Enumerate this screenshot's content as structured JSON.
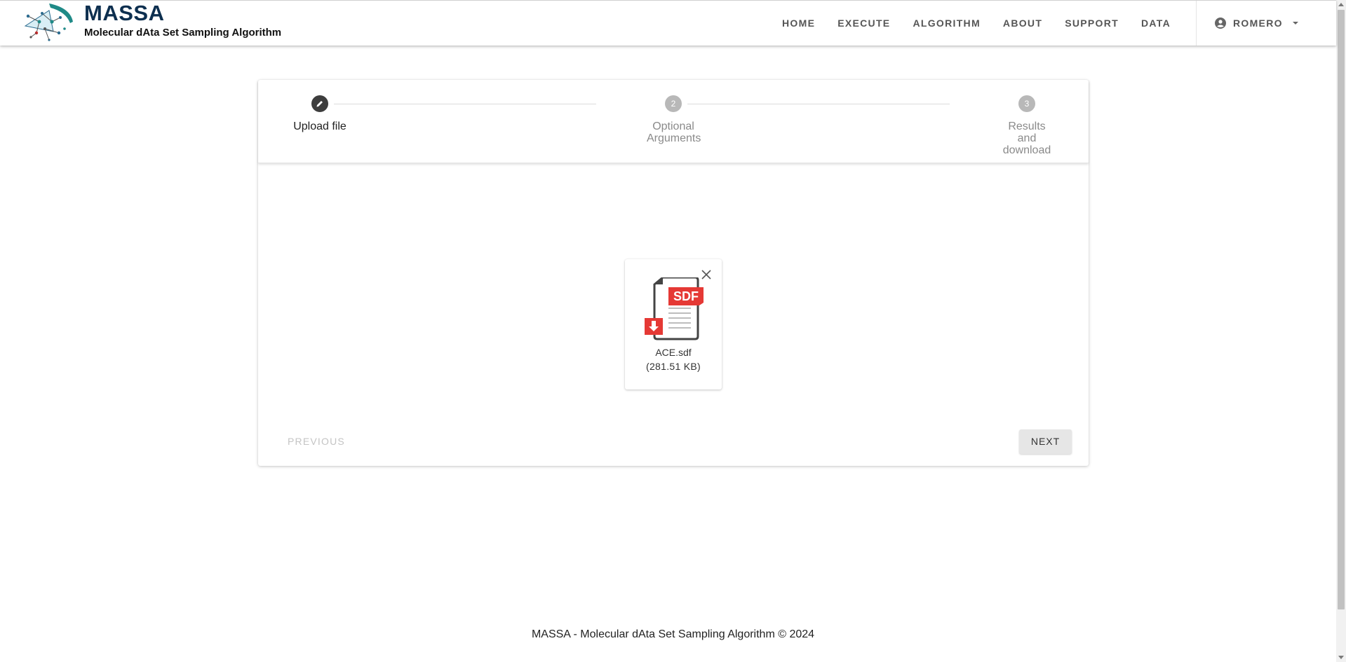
{
  "brand": {
    "title": "MASSA",
    "subtitle": "Molecular dAta Set Sampling Algorithm",
    "logo_icon": "molecule-logo-icon"
  },
  "nav": {
    "items": [
      {
        "label": "HOME"
      },
      {
        "label": "EXECUTE"
      },
      {
        "label": "ALGORITHM"
      },
      {
        "label": "ABOUT"
      },
      {
        "label": "SUPPORT"
      },
      {
        "label": "DATA"
      }
    ],
    "user": {
      "label": "ROMERO",
      "icon": "account-circle-icon"
    }
  },
  "stepper": {
    "steps": [
      {
        "number": "1",
        "label": "Upload file",
        "state": "active",
        "icon": "pencil-icon"
      },
      {
        "number": "2",
        "label": "Optional Arguments",
        "state": "inactive"
      },
      {
        "number": "3",
        "label": "Results and download",
        "state": "inactive"
      }
    ]
  },
  "file": {
    "name": "ACE.sdf",
    "size": "(281.51 KB)",
    "badge": "SDF",
    "icon": "sdf-file-icon"
  },
  "buttons": {
    "previous": "PREVIOUS",
    "next": "NEXT"
  },
  "footer": {
    "text": "MASSA - Molecular dAta Set Sampling Algorithm © 2024"
  },
  "colors": {
    "brand": "#0d2f4f",
    "active_step": "#3d3d3d",
    "inactive_step": "#b8b8b8",
    "file_badge": "#e53935"
  }
}
